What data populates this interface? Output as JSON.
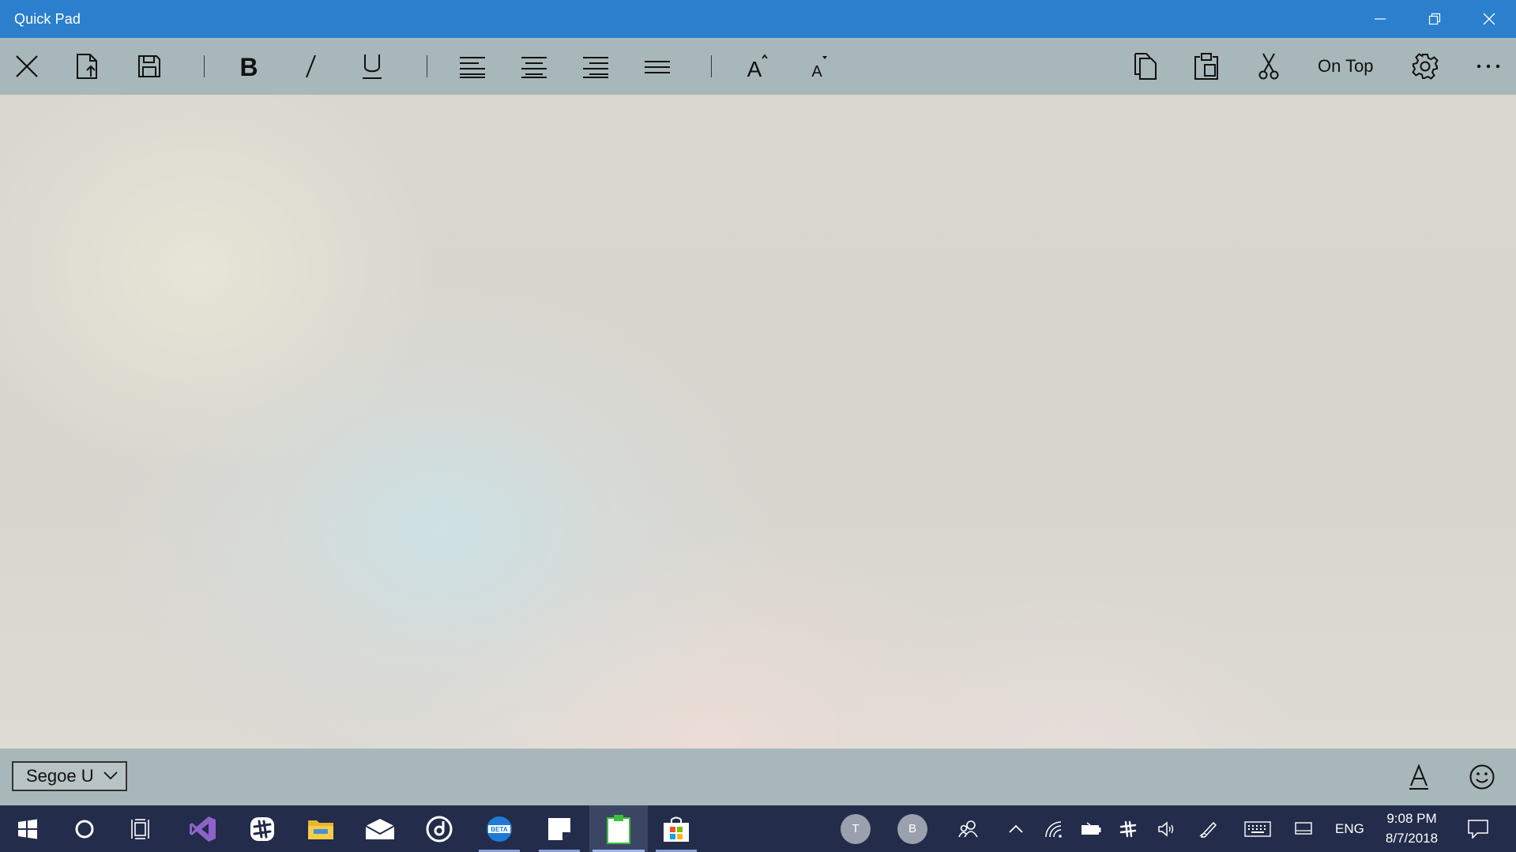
{
  "window": {
    "title": "Quick Pad"
  },
  "toolbar": {
    "on_top_label": "On Top"
  },
  "statusbar": {
    "font_value": "Segoe U"
  },
  "taskbar": {
    "avatar1_initial": "T",
    "avatar2_initial": "B",
    "language": "ENG",
    "time": "9:08 PM",
    "date": "8/7/2018"
  },
  "colors": {
    "titlebar": "#2b7fcd",
    "toolbar": "#a8b7b9",
    "taskbar": "#232c4a"
  }
}
